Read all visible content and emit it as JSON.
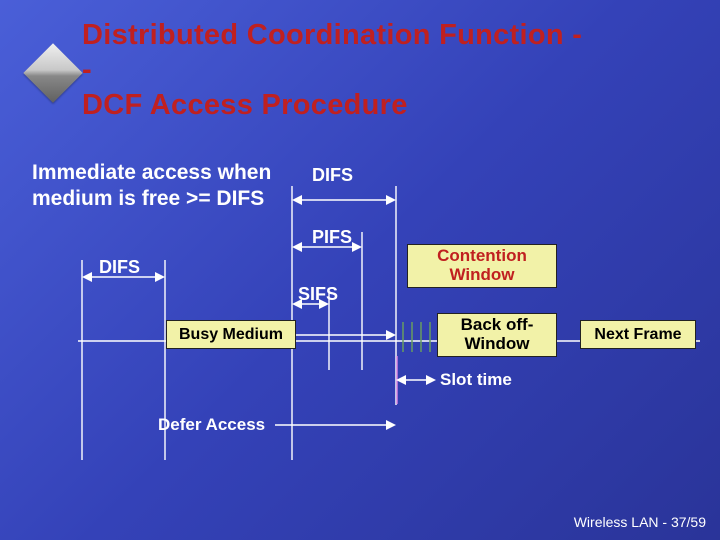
{
  "title_line1": "Distributed Coordination Function -",
  "title_line2": "-",
  "title_line3": "DCF Access Procedure",
  "subtitle_line1": "Immediate access when",
  "subtitle_line2": "medium is free >= DIFS",
  "labels": {
    "difs_top": "DIFS",
    "pifs": "PIFS",
    "difs_left": "DIFS",
    "sifs": "SIFS",
    "slot_time": "Slot time",
    "defer_access": "Defer Access"
  },
  "boxes": {
    "contention_window_l1": "Contention",
    "contention_window_l2": "Window",
    "busy_medium": "Busy Medium",
    "backoff_l1": "Back off-",
    "backoff_l2": "Window",
    "next_frame": "Next Frame"
  },
  "footer": "Wireless LAN - 37/59"
}
